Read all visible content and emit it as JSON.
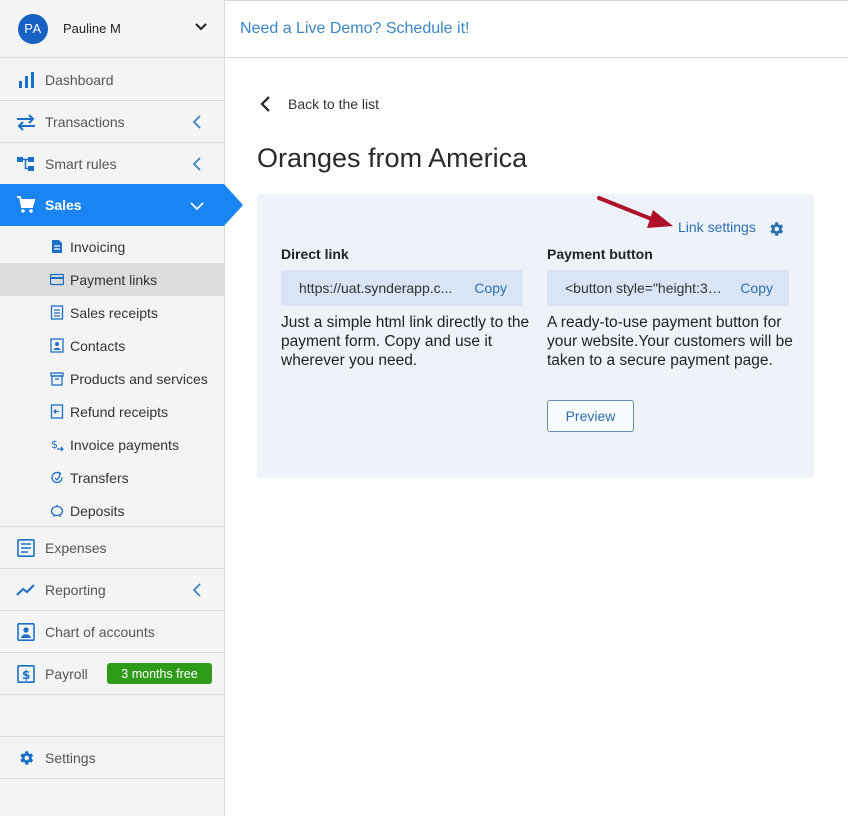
{
  "user": {
    "initials": "PA",
    "name": "Pauline M"
  },
  "banner": {
    "text": "Need a Live Demo? Schedule it!"
  },
  "sidebar": {
    "items": [
      {
        "label": "Dashboard"
      },
      {
        "label": "Transactions"
      },
      {
        "label": "Smart rules"
      },
      {
        "label": "Sales"
      },
      {
        "label": "Expenses"
      },
      {
        "label": "Reporting"
      },
      {
        "label": "Chart of accounts"
      },
      {
        "label": "Payroll",
        "badge": "3 months free"
      },
      {
        "label": "Settings"
      }
    ],
    "sales_sub": [
      {
        "label": "Invoicing"
      },
      {
        "label": "Payment links"
      },
      {
        "label": "Sales receipts"
      },
      {
        "label": "Contacts"
      },
      {
        "label": "Products and services"
      },
      {
        "label": "Refund receipts"
      },
      {
        "label": "Invoice payments"
      },
      {
        "label": "Transfers"
      },
      {
        "label": "Deposits"
      }
    ]
  },
  "main": {
    "back_label": "Back to the list",
    "title": "Oranges from America",
    "link_settings": "Link settings",
    "direct": {
      "title": "Direct link",
      "value": "https://uat.synderapp.c...",
      "copy": "Copy",
      "description": "Just a simple html link directly to the payment form. Copy and use it wherever you need."
    },
    "button": {
      "title": "Payment button",
      "value": "<button style=\"height:32...",
      "copy": "Copy",
      "description": "A ready-to-use payment button for your website.Your customers will be taken to a secure payment page.",
      "preview": "Preview"
    }
  },
  "colors": {
    "accent": "#1a85f2",
    "avatar": "#1760c4",
    "badge": "#2e9b1a",
    "link": "#2c6fae",
    "card_bg": "#eef3fa",
    "annotation_arrow": "#b0102a"
  }
}
